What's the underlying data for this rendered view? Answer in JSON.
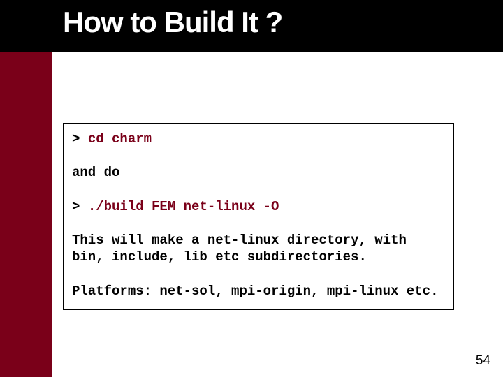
{
  "title": "How to Build It ?",
  "code": {
    "line1_prompt": "> ",
    "line1_cmd": "cd charm",
    "line2": "and do",
    "line3_prompt": "> ",
    "line3_cmd": "./build FEM net-linux -O",
    "line4": "This will make a net-linux directory, with bin, include, lib etc subdirectories.",
    "line5": "Platforms: net-sol, mpi-origin, mpi-linux etc."
  },
  "page_number": "54"
}
